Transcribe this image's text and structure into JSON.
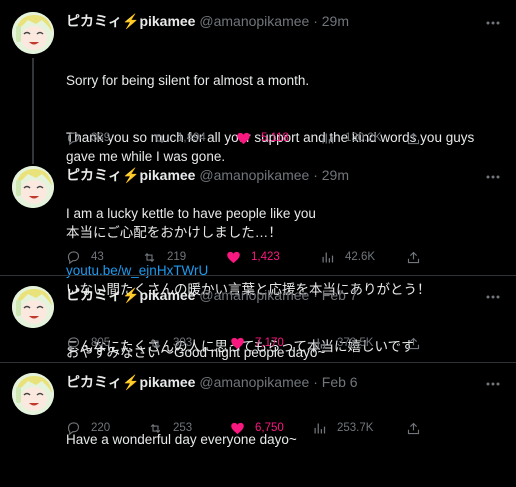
{
  "tweets": [
    {
      "name": "ピカミィ",
      "bolt": "⚡",
      "name2": "pikamee",
      "handle": "@amanopikamee",
      "dot": "·",
      "time": "29m",
      "lines": [
        "Sorry for being silent for almost a month.",
        "Thank you so much for all your support and the kind words you guys gave me while I was gone.",
        "I am a lucky kettle to have people like you"
      ],
      "link": "youtu.be/w_ejnHxTWrU",
      "replies": "389",
      "retweets": "1,494",
      "likes": "5,118",
      "views": "130.2K"
    },
    {
      "name": "ピカミィ",
      "bolt": "⚡",
      "name2": "pikamee",
      "handle": "@amanopikamee",
      "dot": "·",
      "time": "29m",
      "lines": [
        "本当にご心配をおかけしました…！",
        "いない間たくさんの暖かい言葉と応援を本当にありがとう！",
        "こんなにたくさんの人に思ってもらって本当に嬉しいです"
      ],
      "replies": "43",
      "retweets": "219",
      "likes": "1,423",
      "views": "42.6K"
    },
    {
      "name": "ピカミィ",
      "bolt": "⚡",
      "name2": "pikamee",
      "handle": "@amanopikamee",
      "dot": "·",
      "time": "Feb 7",
      "lines": [
        "おやすみなさい〜Good night people dayo~"
      ],
      "replies": "805",
      "retweets": "303",
      "likes": "7,170",
      "views": "372.5K"
    },
    {
      "name": "ピカミィ",
      "bolt": "⚡",
      "name2": "pikamee",
      "handle": "@amanopikamee",
      "dot": "·",
      "time": "Feb 6",
      "lines": [
        "Have a wonderful day everyone dayo~"
      ],
      "replies": "220",
      "retweets": "253",
      "likes": "6,750",
      "views": "253.7K"
    }
  ],
  "colors": {
    "background": "#000000",
    "text": "#e7e9ea",
    "muted": "#71767b",
    "link": "#1d9bf0",
    "like": "#f91880"
  },
  "icons": [
    "more-icon",
    "reply-icon",
    "retweet-icon",
    "heart-icon",
    "views-icon",
    "share-icon"
  ]
}
